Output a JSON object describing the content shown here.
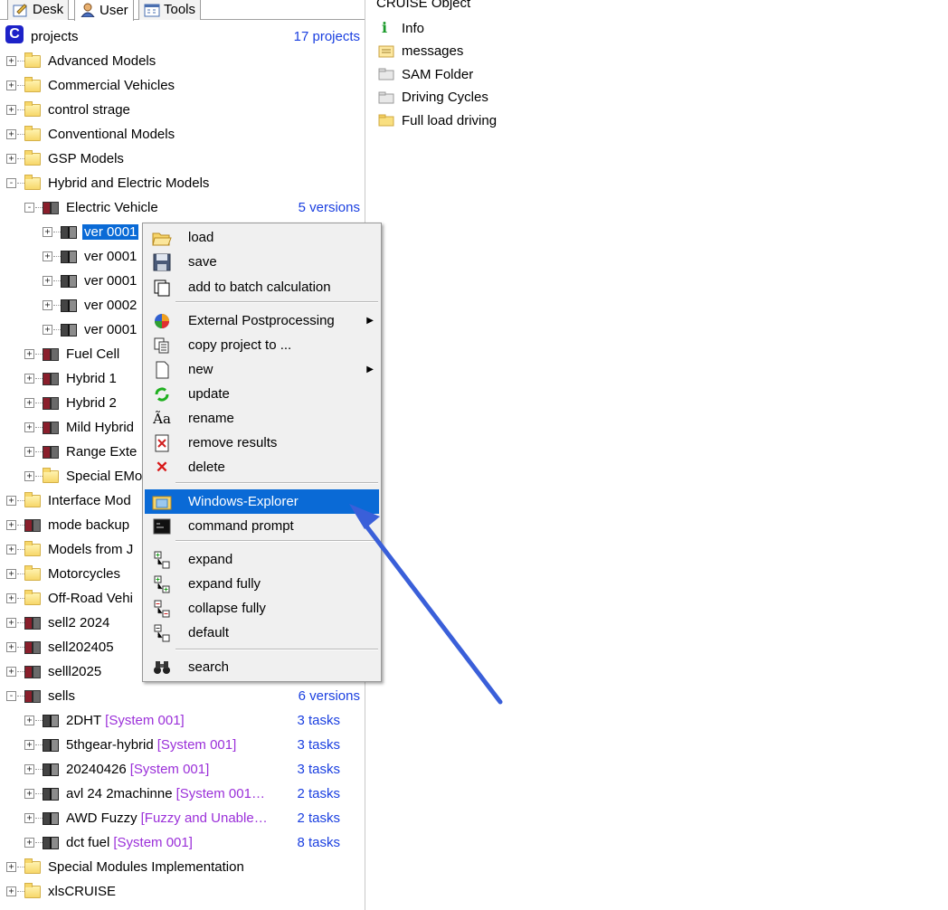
{
  "tabs": [
    {
      "label": "Desk",
      "icon": "desk-icon"
    },
    {
      "label": "User",
      "icon": "user-icon"
    },
    {
      "label": "Tools",
      "icon": "tools-icon"
    }
  ],
  "tree": {
    "root": {
      "label": "projects",
      "count": "17 projects"
    },
    "items": [
      {
        "label": "Advanced Models"
      },
      {
        "label": "Commercial Vehicles"
      },
      {
        "label": "control strage"
      },
      {
        "label": "Conventional Models"
      },
      {
        "label": "GSP Models"
      },
      {
        "label": "Hybrid and Electric Models"
      },
      {
        "label": "Electric Vehicle",
        "count": "5 versions"
      },
      {
        "label": "ver 0001"
      },
      {
        "label": "ver 0001"
      },
      {
        "label": "ver 0001"
      },
      {
        "label": "ver 0002"
      },
      {
        "label": "ver 0001"
      },
      {
        "label": "Fuel Cell"
      },
      {
        "label": "Hybrid 1"
      },
      {
        "label": "Hybrid 2"
      },
      {
        "label": "Mild Hybrid"
      },
      {
        "label": "Range Exte"
      },
      {
        "label": "Special EMo"
      },
      {
        "label": "Interface Mod"
      },
      {
        "label": "mode backup"
      },
      {
        "label": "Models from J"
      },
      {
        "label": "Motorcycles"
      },
      {
        "label": "Off-Road Vehi"
      },
      {
        "label": "sell2 2024"
      },
      {
        "label": "sell202405"
      },
      {
        "label": "selll2025"
      },
      {
        "label": "sells",
        "count": "6 versions"
      },
      {
        "label": "2DHT",
        "tag": "[System 001]",
        "count": "3 tasks"
      },
      {
        "label": "5thgear-hybrid",
        "tag": "[System 001]",
        "count": "3 tasks"
      },
      {
        "label": "20240426",
        "tag": "[System 001]",
        "count": "3 tasks"
      },
      {
        "label": "avl 24 2machinne",
        "tag": "[System 001…",
        "count": "2 tasks"
      },
      {
        "label": "AWD Fuzzy",
        "tag": "[Fuzzy and Unable…",
        "count": "2 tasks"
      },
      {
        "label": "dct fuel",
        "tag": "[System 001]",
        "count": "8 tasks"
      },
      {
        "label": "Special Modules Implementation"
      },
      {
        "label": "xlsCRUISE"
      }
    ]
  },
  "right_panel": {
    "title": "CRUISE Object",
    "items": [
      {
        "label": "Info",
        "icon": "info-icon"
      },
      {
        "label": "messages",
        "icon": "messages-icon"
      },
      {
        "label": "SAM Folder",
        "icon": "gray-folder-icon"
      },
      {
        "label": "Driving Cycles",
        "icon": "gray-folder-icon"
      },
      {
        "label": "Full load driving",
        "icon": "folder-icon"
      }
    ]
  },
  "context_menu": {
    "items": [
      {
        "label": "load",
        "icon": "open-folder-icon"
      },
      {
        "label": "save",
        "icon": "floppy-icon"
      },
      {
        "label": "add to batch calculation",
        "icon": "batch-icon"
      },
      {
        "label": "External Postprocessing",
        "icon": "chart-icon",
        "submenu": true
      },
      {
        "label": "copy project to ...",
        "icon": "copy-icon"
      },
      {
        "label": "new",
        "icon": "new-icon",
        "submenu": true
      },
      {
        "label": "update",
        "icon": "refresh-icon"
      },
      {
        "label": "rename",
        "icon": "rename-icon"
      },
      {
        "label": "remove results",
        "icon": "remove-results-icon"
      },
      {
        "label": "delete",
        "icon": "delete-icon"
      },
      {
        "label": "Windows-Explorer",
        "icon": "explorer-icon",
        "highlighted": true
      },
      {
        "label": "command prompt",
        "icon": "cmd-icon"
      },
      {
        "label": "expand",
        "icon": "expand-icon"
      },
      {
        "label": "expand fully",
        "icon": "expand-fully-icon"
      },
      {
        "label": "collapse fully",
        "icon": "collapse-fully-icon"
      },
      {
        "label": "default",
        "icon": "default-icon"
      },
      {
        "label": "search",
        "icon": "binoculars-icon"
      }
    ]
  },
  "colors": {
    "selection": "#0a6ad6",
    "count_text": "#1a3fe0",
    "tag_text": "#9b30d9",
    "annotation_arrow": "#3a5fd9"
  }
}
